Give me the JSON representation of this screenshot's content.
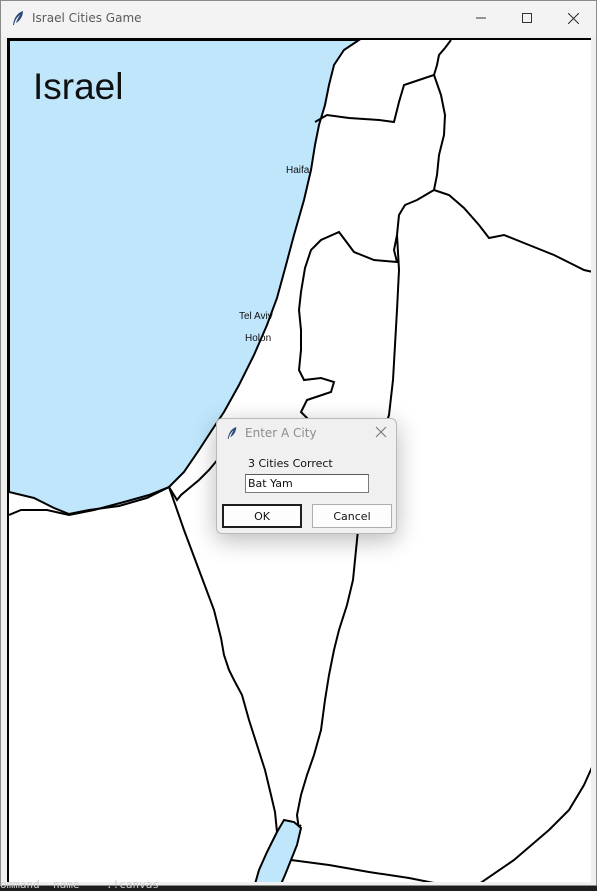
{
  "window": {
    "title": "Israel Cities Game"
  },
  "map": {
    "title": "Israel",
    "sea_color": "#bfe6fb",
    "land_color": "#ffffff",
    "border_color": "#000000",
    "cities": [
      "Haifa",
      "Tel Aviv",
      "Holon"
    ]
  },
  "dialog": {
    "title": "Enter A City",
    "prompt": "3 Cities Correct",
    "input_value": "Bat Yam",
    "ok_label": "OK",
    "cancel_label": "Cancel"
  },
  "console": {
    "text": "ommand  name    .!canvas"
  }
}
